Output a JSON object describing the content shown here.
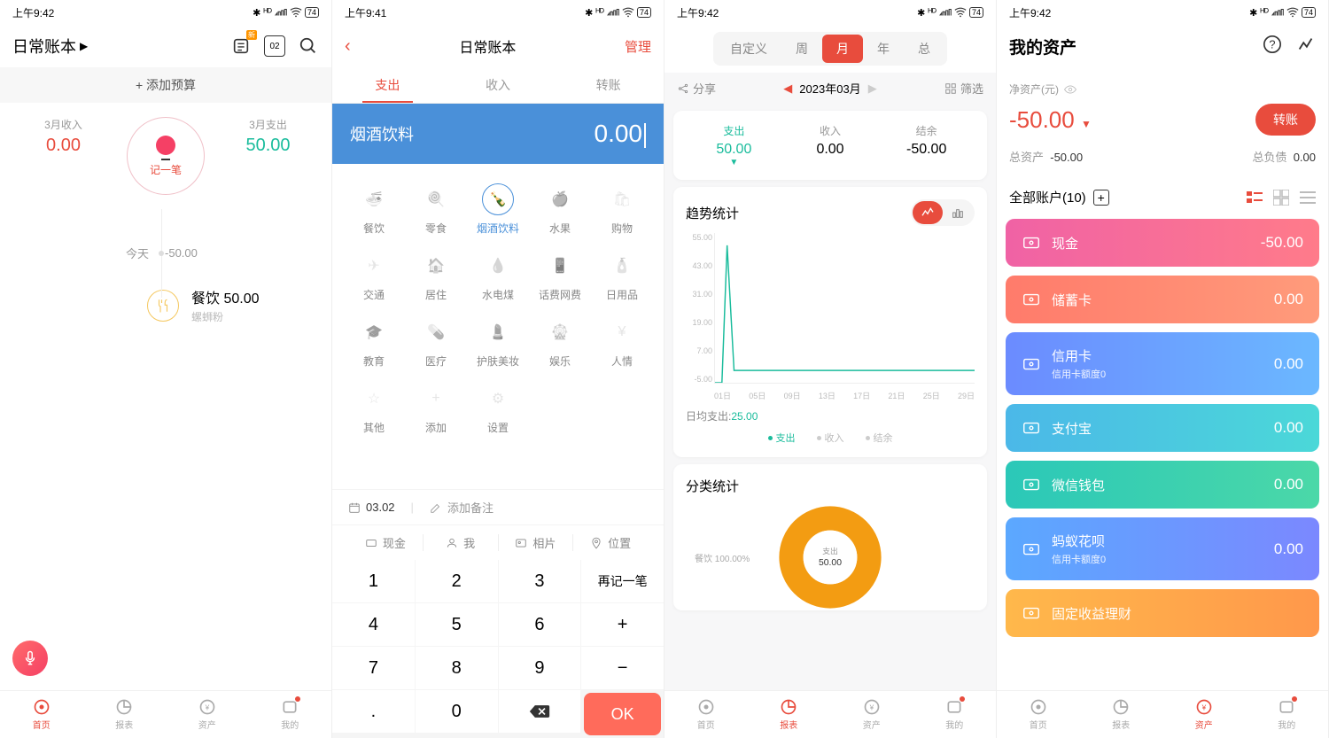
{
  "status": {
    "time1": "上午9:42",
    "time2": "上午9:41",
    "battery": "74"
  },
  "s1": {
    "title": "日常账本",
    "calDay": "02",
    "calBadge": "新",
    "addBudget": "+ 添加预算",
    "monthIncome": "3月收入",
    "incomeVal": "0.00",
    "monthExpense": "3月支出",
    "expenseVal": "50.00",
    "recordBtn": "记一笔",
    "today": "今天",
    "todayAmt": "-50.00",
    "entryName": "餐饮",
    "entryAmt": "50.00",
    "entryNote": "螺蛳粉"
  },
  "s2": {
    "title": "日常账本",
    "manage": "管理",
    "tabs": [
      "支出",
      "收入",
      "转账"
    ],
    "category": "烟酒饮料",
    "amount": "0.00",
    "cats": [
      "餐饮",
      "零食",
      "烟酒饮料",
      "水果",
      "购物",
      "交通",
      "居住",
      "水电煤",
      "话费网费",
      "日用品",
      "教育",
      "医疗",
      "护肤美妆",
      "娱乐",
      "人情",
      "其他",
      "添加",
      "设置"
    ],
    "date": "03.02",
    "memo": "添加备注",
    "account": "现金",
    "member": "我",
    "photo": "相片",
    "location": "位置",
    "keys": [
      "1",
      "2",
      "3",
      "再记一笔",
      "4",
      "5",
      "6",
      "+",
      "7",
      "8",
      "9",
      "−",
      ".",
      "0",
      "del",
      "OK"
    ]
  },
  "s3": {
    "rangeTabs": [
      "自定义",
      "周",
      "月",
      "年",
      "总"
    ],
    "share": "分享",
    "date": "2023年03月",
    "filter": "筛选",
    "stats": [
      {
        "label": "支出",
        "val": "50.00",
        "active": true
      },
      {
        "label": "收入",
        "val": "0.00"
      },
      {
        "label": "结余",
        "val": "-50.00"
      }
    ],
    "trendTitle": "趋势统计",
    "avgLabel": "日均支出:",
    "avgVal": "25.00",
    "legend": [
      "支出",
      "收入",
      "结余"
    ],
    "catTitle": "分类统计",
    "donutLabel": "餐饮 100.00%",
    "donutCenter1": "支出",
    "donutCenter2": "50.00"
  },
  "s4": {
    "title": "我的资产",
    "netLabel": "净资产(元)",
    "netVal": "-50.00",
    "transfer": "转账",
    "totalAssetsLabel": "总资产",
    "totalAssets": "-50.00",
    "totalDebtLabel": "总负债",
    "totalDebt": "0.00",
    "accountsTitle": "全部账户(10)",
    "accounts": [
      {
        "name": "现金",
        "val": "-50.00",
        "bg": "linear-gradient(90deg,#f062a5,#ff7b8a)"
      },
      {
        "name": "储蓄卡",
        "val": "0.00",
        "bg": "linear-gradient(90deg,#ff7b6b,#ff9b7b)"
      },
      {
        "name": "信用卡",
        "sub": "信用卡额度0",
        "val": "0.00",
        "bg": "linear-gradient(90deg,#6b8bff,#6bb8ff)"
      },
      {
        "name": "支付宝",
        "val": "0.00",
        "bg": "linear-gradient(90deg,#4bb8e8,#4bd8d8)"
      },
      {
        "name": "微信钱包",
        "val": "0.00",
        "bg": "linear-gradient(90deg,#2bc8b8,#4bd8a8)"
      },
      {
        "name": "蚂蚁花呗",
        "sub": "信用卡额度0",
        "val": "0.00",
        "bg": "linear-gradient(90deg,#5ba8ff,#7b88ff)"
      },
      {
        "name": "固定收益理财",
        "val": "",
        "bg": "linear-gradient(90deg,#ffb84b,#ff984b)"
      }
    ]
  },
  "nav": [
    "首页",
    "报表",
    "资产",
    "我的"
  ],
  "chart_data": {
    "type": "line",
    "title": "趋势统计",
    "xlabel": "",
    "ylabel": "",
    "x": [
      "01日",
      "05日",
      "09日",
      "13日",
      "17日",
      "21日",
      "25日",
      "29日"
    ],
    "ylim": [
      -5,
      55
    ],
    "y_ticks": [
      55.0,
      43.0,
      31.0,
      19.0,
      7.0,
      -5.0
    ],
    "series": [
      {
        "name": "支出",
        "color": "#1abc9c",
        "values_by_day": {
          "1": 0,
          "2": 50,
          "3": 0,
          "4": 0
        },
        "plateau_after_day3": 0
      }
    ],
    "donut": {
      "type": "pie",
      "slices": [
        {
          "label": "餐饮",
          "pct": 100.0
        }
      ],
      "center_label": "支出",
      "center_value": 50.0
    }
  }
}
